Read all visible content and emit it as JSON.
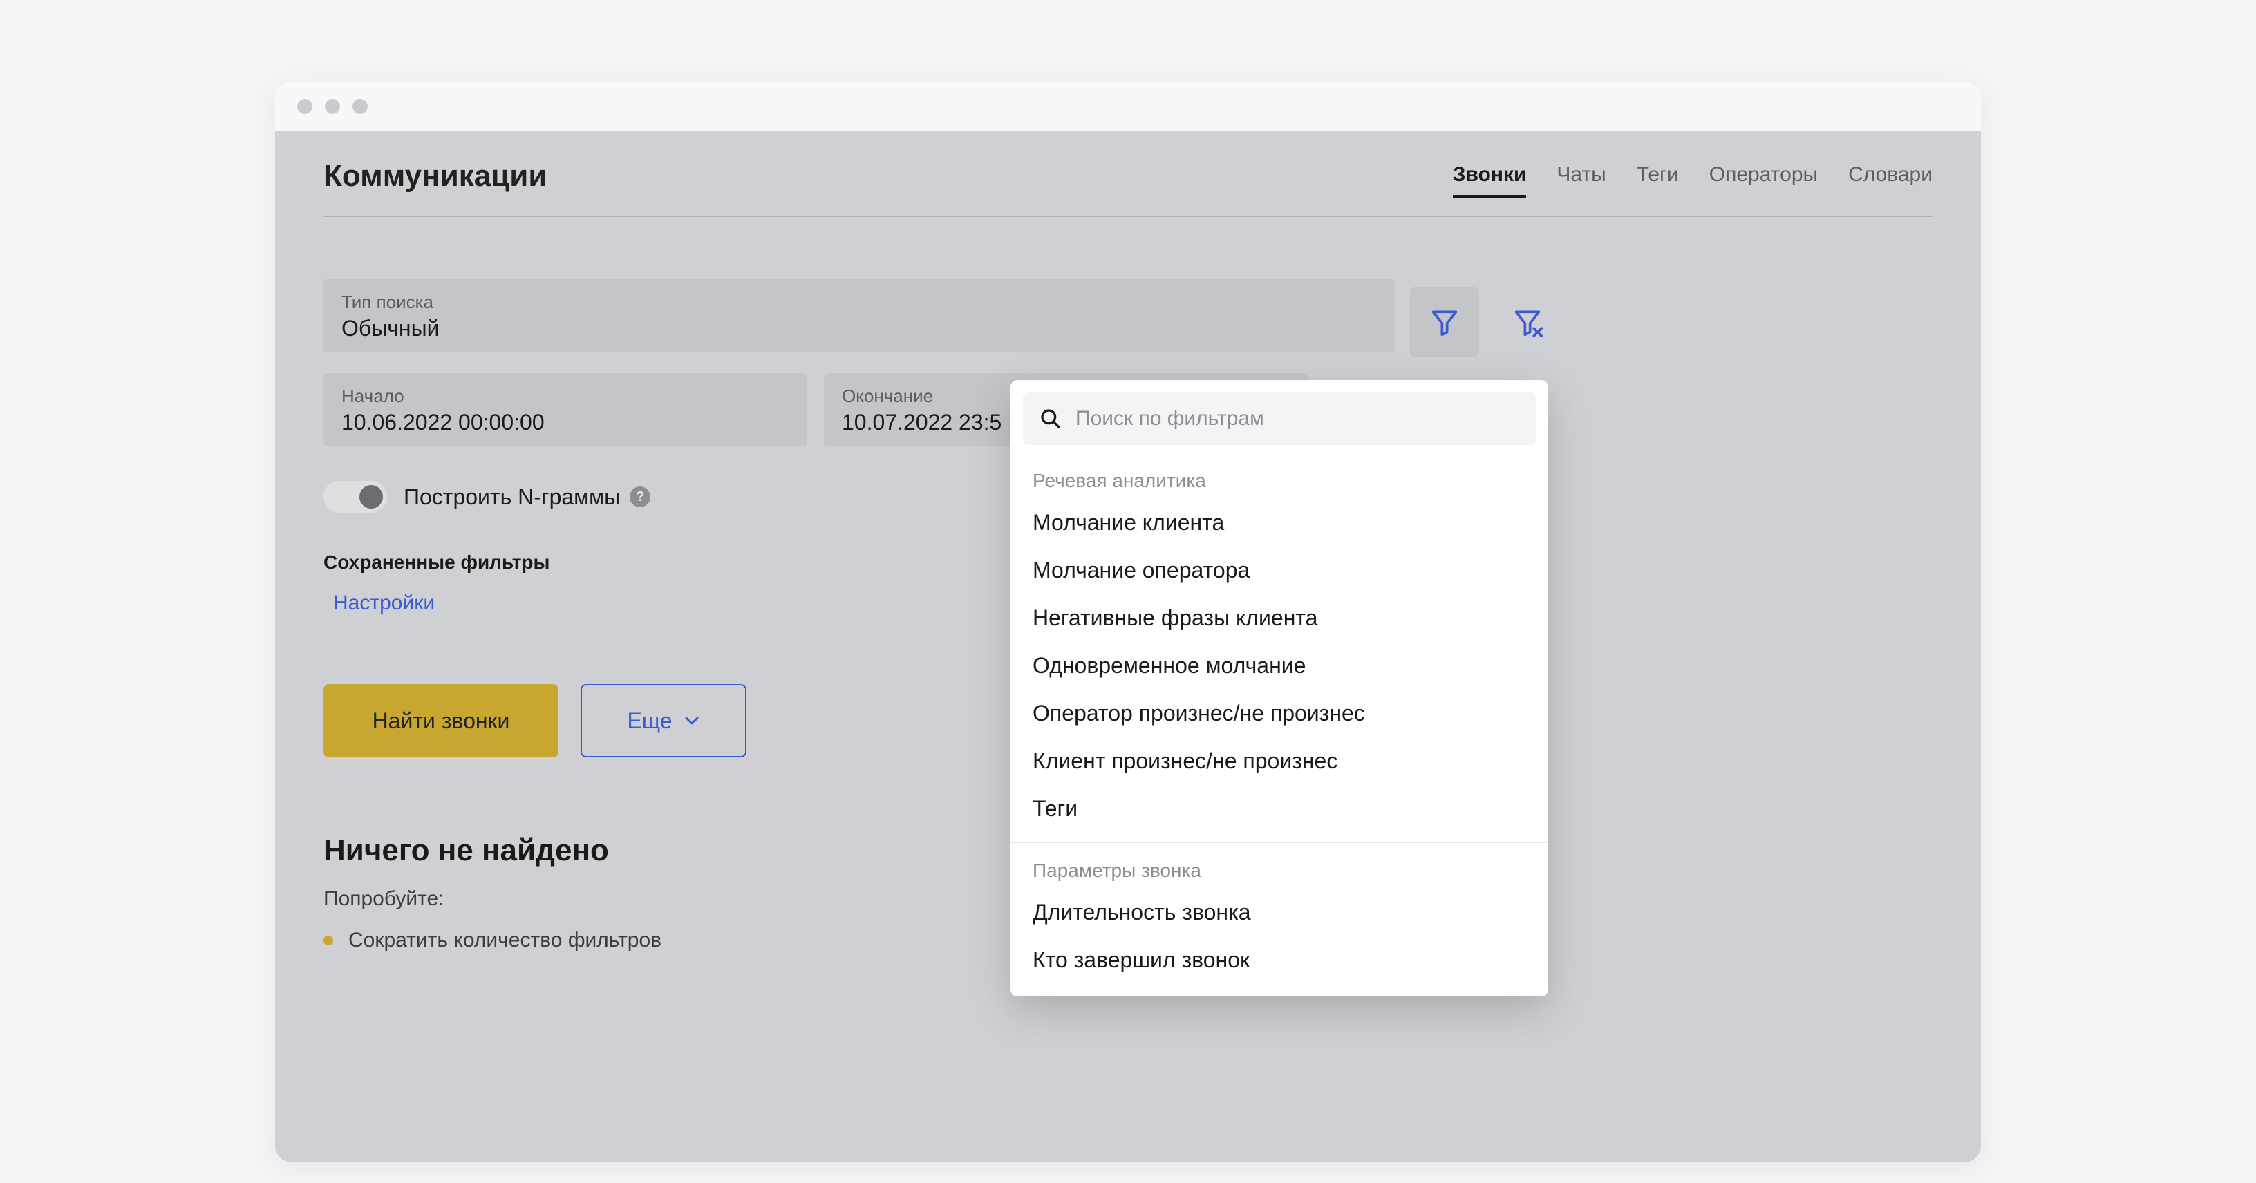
{
  "page_title": "Коммуникации",
  "tabs": [
    {
      "label": "Звонки",
      "active": true
    },
    {
      "label": "Чаты",
      "active": false
    },
    {
      "label": "Теги",
      "active": false
    },
    {
      "label": "Операторы",
      "active": false
    },
    {
      "label": "Словари",
      "active": false
    }
  ],
  "search_type": {
    "label": "Тип поиска",
    "value": "Обычный"
  },
  "date_start": {
    "label": "Начало",
    "value": "10.06.2022 00:00:00"
  },
  "date_end": {
    "label": "Окончание",
    "value": "10.07.2022 23:5"
  },
  "ngram_toggle_label": "Построить N-граммы",
  "saved_filters_label": "Сохраненные фильтры",
  "saved_filters_link": "Настройки",
  "find_button": "Найти звонки",
  "more_button": "Еще",
  "results": {
    "heading": "Ничего не найдено",
    "try_label": "Попробуйте:",
    "hints": [
      "Сократить количество фильтров"
    ]
  },
  "popover": {
    "search_placeholder": "Поиск по фильтрам",
    "groups": [
      {
        "title": "Речевая аналитика",
        "items": [
          "Молчание клиента",
          "Молчание оператора",
          "Негативные фразы клиента",
          "Одновременное молчание",
          "Оператор произнес/не произнес",
          "Клиент произнес/не произнес",
          "Теги"
        ]
      },
      {
        "title": "Параметры звонка",
        "items": [
          "Длительность звонка",
          "Кто завершил звонок"
        ]
      }
    ]
  },
  "colors": {
    "accent_blue": "#3b5bd1",
    "accent_yellow": "#c7a72f"
  }
}
